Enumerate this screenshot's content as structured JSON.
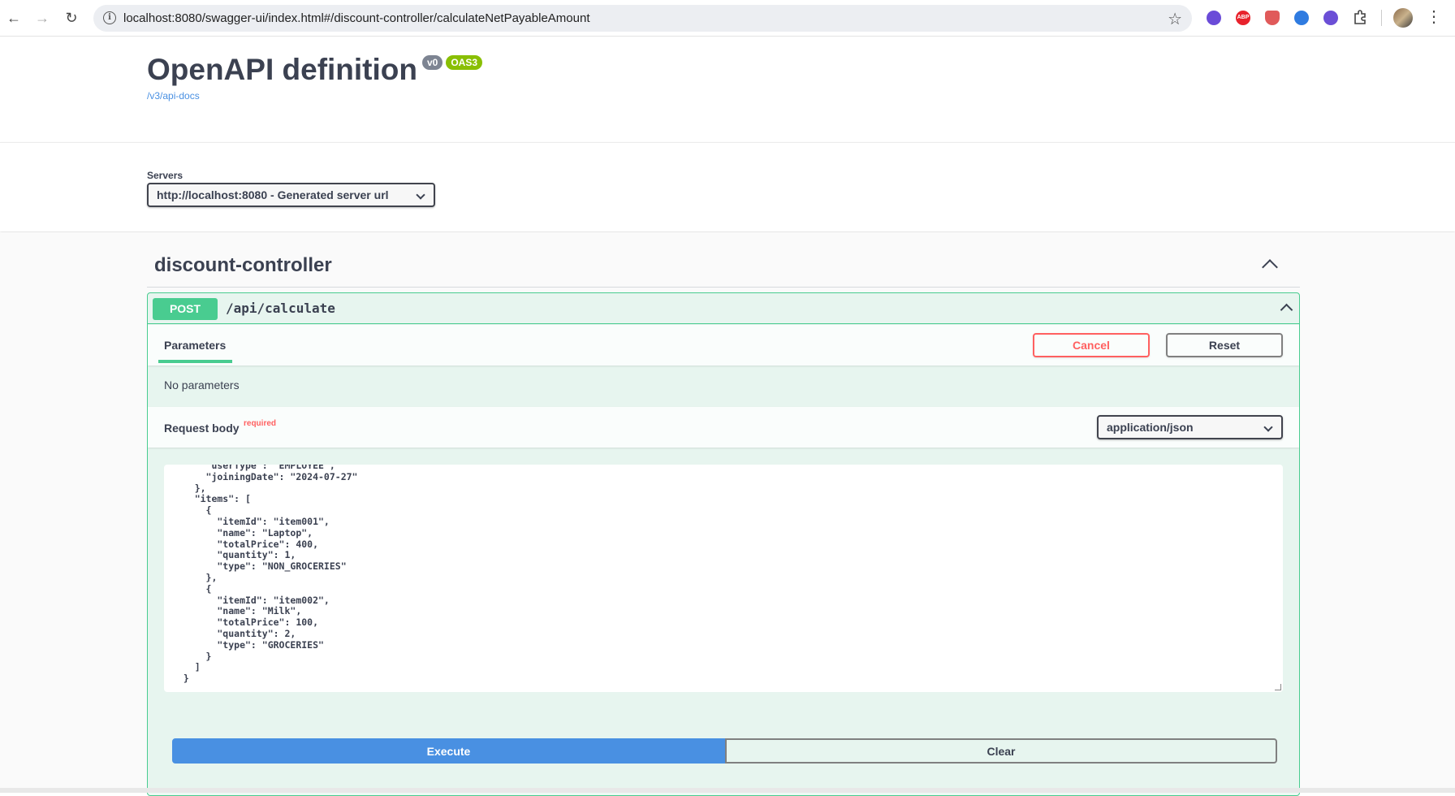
{
  "browser": {
    "url": "localhost:8080/swagger-ui/index.html#/discount-controller/calculateNetPayableAmount",
    "extensions": [
      {
        "name": "extension-purple",
        "color": "#6a4bd8",
        "label": ""
      },
      {
        "name": "adblock-plus",
        "color": "#e8222c",
        "label": "ABP"
      },
      {
        "name": "shield-extension",
        "color": "#e05a5a",
        "label": ""
      },
      {
        "name": "globe-extension",
        "color": "#2f7be0",
        "label": ""
      },
      {
        "name": "pulse-extension",
        "color": "#6b4fd6",
        "label": ""
      }
    ]
  },
  "info": {
    "title": "OpenAPI definition",
    "version": "v0",
    "oas": "OAS3",
    "docs_link": "/v3/api-docs"
  },
  "servers": {
    "label": "Servers",
    "selected": "http://localhost:8080 - Generated server url"
  },
  "tag": {
    "name": "discount-controller"
  },
  "operation": {
    "method": "POST",
    "path": "/api/calculate",
    "tab": "Parameters",
    "cancel_label": "Cancel",
    "reset_label": "Reset",
    "no_params": "No parameters",
    "request_body_label": "Request body",
    "required_label": "required",
    "content_type": "application/json",
    "body_text": "      \"userType\": \"EMPLOYEE\",\n      \"joiningDate\": \"2024-07-27\"\n    },\n    \"items\": [\n      {\n        \"itemId\": \"item001\",\n        \"name\": \"Laptop\",\n        \"totalPrice\": 400,\n        \"quantity\": 1,\n        \"type\": \"NON_GROCERIES\"\n      },\n      {\n        \"itemId\": \"item002\",\n        \"name\": \"Milk\",\n        \"totalPrice\": 100,\n        \"quantity\": 2,\n        \"type\": \"GROCERIES\"\n      }\n    ]\n  }",
    "execute_label": "Execute",
    "clear_label": "Clear"
  },
  "colors": {
    "post": "#49cc90",
    "execute": "#4990e2",
    "cancel": "#ff6060",
    "oas_badge": "#89bf04"
  }
}
